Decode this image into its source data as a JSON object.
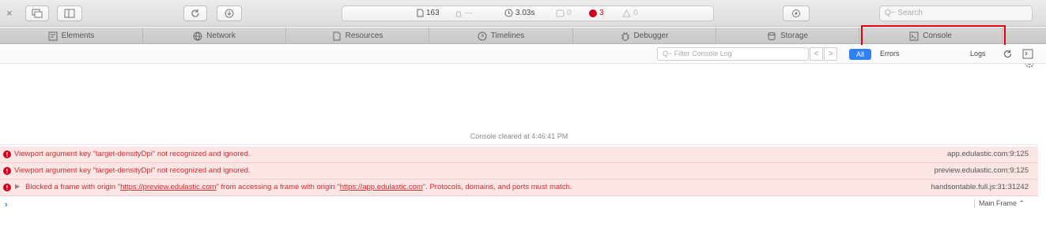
{
  "toolbar": {
    "close_symbol": "×",
    "dashboard": {
      "resources_count": "163",
      "size_value": "—",
      "time_value": "3.03s",
      "logs_count": "0",
      "errors_count": "3",
      "warnings_count": "0"
    },
    "search_placeholder": "Q~ Search"
  },
  "tabs": [
    {
      "label": "Elements",
      "icon": "elements-icon"
    },
    {
      "label": "Network",
      "icon": "network-icon"
    },
    {
      "label": "Resources",
      "icon": "resources-icon"
    },
    {
      "label": "Timelines",
      "icon": "timelines-icon"
    },
    {
      "label": "Debugger",
      "icon": "debugger-icon"
    },
    {
      "label": "Storage",
      "icon": "storage-icon"
    },
    {
      "label": "Console",
      "icon": "console-icon",
      "selected": true
    }
  ],
  "filter": {
    "placeholder": "Q~ Filter Console Log",
    "prev": "<",
    "next": ">",
    "all_label": "All",
    "errors_label": "Errors",
    "logs_label": "Logs"
  },
  "console": {
    "cleared_text": "Console cleared at 4:46:41 PM",
    "messages": [
      {
        "text": "Viewport argument key \"target-densityDpi\" not recognized and ignored.",
        "source": "app.edulastic.com:9:125"
      },
      {
        "text": "Viewport argument key \"target-densityDpi\" not recognized and ignored.",
        "source": "preview.edulastic.com:9:125"
      },
      {
        "prefix": "Blocked a frame with origin \"",
        "link1": "https://preview.edulastic.com",
        "middle": "\" from accessing a frame with origin \"",
        "link2": "https://app.edulastic.com",
        "suffix": "\". Protocols, domains, and ports must match.",
        "source": "handsontable.full.js:31:31242"
      }
    ],
    "prompt_symbol": "›",
    "frame_selector": "Main Frame ⌃"
  },
  "colors": {
    "error": "#d0021b",
    "accent": "#2f7ff5",
    "highlight": "#e0000f"
  }
}
